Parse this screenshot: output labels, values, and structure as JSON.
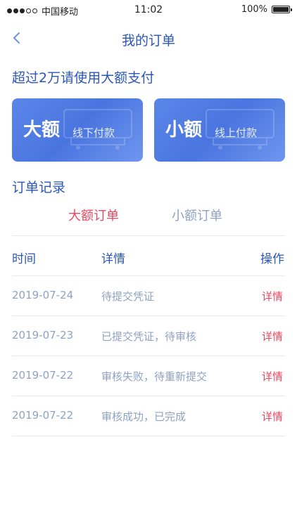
{
  "status_bar": {
    "carrier": "中国移动",
    "time": "11:02",
    "battery": "100%"
  },
  "nav": {
    "title": "我的订单"
  },
  "hint": "超过2万请使用大额支付",
  "cards": [
    {
      "title": "大额",
      "subtitle": "线下付款"
    },
    {
      "title": "小额",
      "subtitle": "线上付款"
    }
  ],
  "records_title": "订单记录",
  "tabs": [
    {
      "label": "大额订单",
      "active": true
    },
    {
      "label": "小额订单",
      "active": false
    }
  ],
  "table": {
    "headers": [
      "时间",
      "详情",
      "操作"
    ],
    "rows": [
      {
        "date": "2019-07-24",
        "status": "待提交凭证",
        "action": "详情"
      },
      {
        "date": "2019-07-23",
        "status": "已提交凭证，待审核",
        "action": "详情"
      },
      {
        "date": "2019-07-22",
        "status": "审核失败，待重新提交",
        "action": "详情"
      },
      {
        "date": "2019-07-22",
        "status": "审核成功，已完成",
        "action": "详情"
      }
    ]
  },
  "colors": {
    "primary": "#2b57b8",
    "accent": "#e8475f",
    "muted": "#8fa2c4",
    "card": "#5b86e8"
  },
  "icons": [
    "back-chevron-icon",
    "signal-dots-icon",
    "battery-icon"
  ]
}
